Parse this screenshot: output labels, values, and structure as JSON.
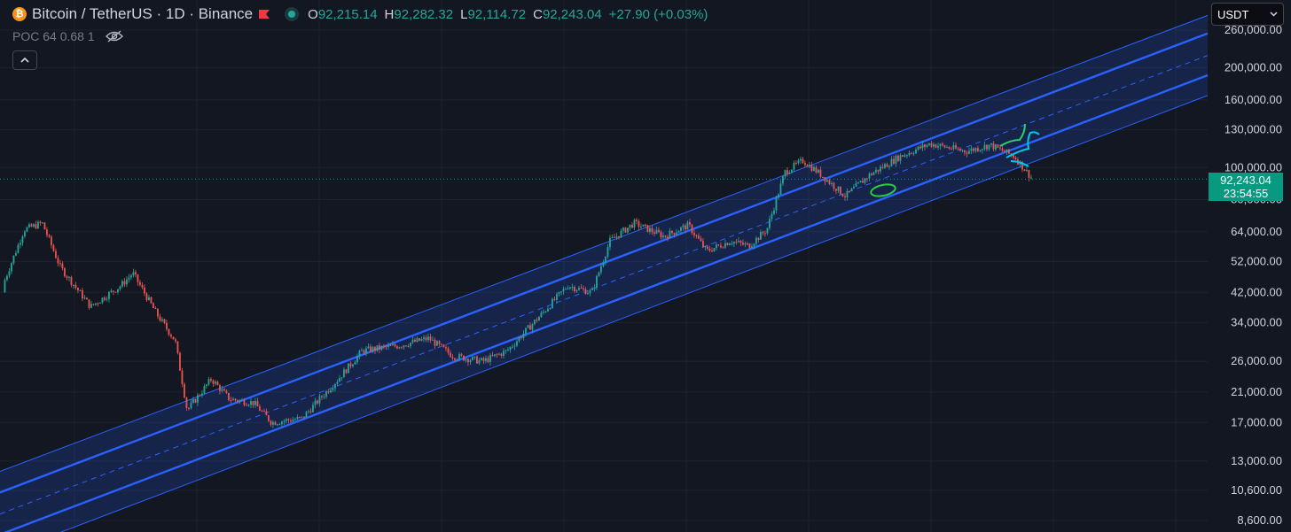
{
  "header": {
    "symbol_title": "Bitcoin / TetherUS · 1D · Binance",
    "coin_glyph": "₿",
    "ohlc": [
      {
        "key": "O",
        "value": "92,215.14"
      },
      {
        "key": "H",
        "value": "92,282.32"
      },
      {
        "key": "L",
        "value": "92,114.72"
      },
      {
        "key": "C",
        "value": "92,243.04"
      }
    ],
    "change": "+27.90 (+0.03%)"
  },
  "indicator": {
    "label": "POC 64 0.68 1"
  },
  "currency": {
    "selected": "USDT"
  },
  "price_label": {
    "price": "92,243.04",
    "countdown": "23:54:55"
  },
  "colors": {
    "background": "#131722",
    "up": "#26a69a",
    "down": "#ef5350",
    "channel_line": "#2962ff",
    "channel_fill": "rgba(41,98,255,0.18)",
    "price_line": "#089981"
  },
  "chart_data": {
    "type": "candlestick",
    "scale": "log",
    "current_price": 92243.04,
    "y_ticks": [
      {
        "label": "260,000.00",
        "value": 260000
      },
      {
        "label": "200,000.00",
        "value": 200000
      },
      {
        "label": "160,000.00",
        "value": 160000
      },
      {
        "label": "130,000.00",
        "value": 130000
      },
      {
        "label": "100,000.00",
        "value": 100000
      },
      {
        "label": "80,000.00",
        "value": 80000
      },
      {
        "label": "64,000.00",
        "value": 64000
      },
      {
        "label": "52,000.00",
        "value": 52000
      },
      {
        "label": "42,000.00",
        "value": 42000
      },
      {
        "label": "34,000.00",
        "value": 34000
      },
      {
        "label": "26,000.00",
        "value": 26000
      },
      {
        "label": "21,000.00",
        "value": 21000
      },
      {
        "label": "17,000.00",
        "value": 17000
      },
      {
        "label": "13,000.00",
        "value": 13000
      },
      {
        "label": "10,600.00",
        "value": 10600
      },
      {
        "label": "8,600.00",
        "value": 8600
      }
    ],
    "price_path": [
      [
        0,
        42000
      ],
      [
        0.02,
        65000
      ],
      [
        0.035,
        68000
      ],
      [
        0.05,
        50000
      ],
      [
        0.075,
        38000
      ],
      [
        0.1,
        44000
      ],
      [
        0.11,
        48000
      ],
      [
        0.13,
        36000
      ],
      [
        0.145,
        30000
      ],
      [
        0.155,
        18500
      ],
      [
        0.175,
        23000
      ],
      [
        0.19,
        20000
      ],
      [
        0.21,
        19500
      ],
      [
        0.225,
        17000
      ],
      [
        0.25,
        17500
      ],
      [
        0.28,
        23000
      ],
      [
        0.3,
        28000
      ],
      [
        0.33,
        29000
      ],
      [
        0.355,
        30500
      ],
      [
        0.375,
        27000
      ],
      [
        0.4,
        26000
      ],
      [
        0.42,
        28000
      ],
      [
        0.445,
        35000
      ],
      [
        0.47,
        44000
      ],
      [
        0.49,
        42000
      ],
      [
        0.505,
        60000
      ],
      [
        0.525,
        68000
      ],
      [
        0.55,
        62000
      ],
      [
        0.57,
        67000
      ],
      [
        0.585,
        56000
      ],
      [
        0.605,
        60000
      ],
      [
        0.62,
        58000
      ],
      [
        0.635,
        65000
      ],
      [
        0.65,
        97000
      ],
      [
        0.665,
        105000
      ],
      [
        0.68,
        95000
      ],
      [
        0.7,
        82000
      ],
      [
        0.72,
        95000
      ],
      [
        0.745,
        108000
      ],
      [
        0.77,
        118000
      ],
      [
        0.8,
        112000
      ],
      [
        0.82,
        117000
      ],
      [
        0.84,
        108000
      ],
      [
        0.855,
        92243
      ]
    ],
    "channel": {
      "outer_upper": [
        [
          0,
          12100
        ],
        [
          1,
          288000
        ]
      ],
      "upper": [
        [
          0,
          10450
        ],
        [
          1,
          254000
        ]
      ],
      "mid": [
        [
          0,
          9000
        ],
        [
          1,
          218000
        ]
      ],
      "lower": [
        [
          0,
          7800
        ],
        [
          1,
          190000
        ]
      ],
      "outer_lower": [
        [
          0,
          6750
        ],
        [
          1,
          165000
        ]
      ]
    }
  }
}
